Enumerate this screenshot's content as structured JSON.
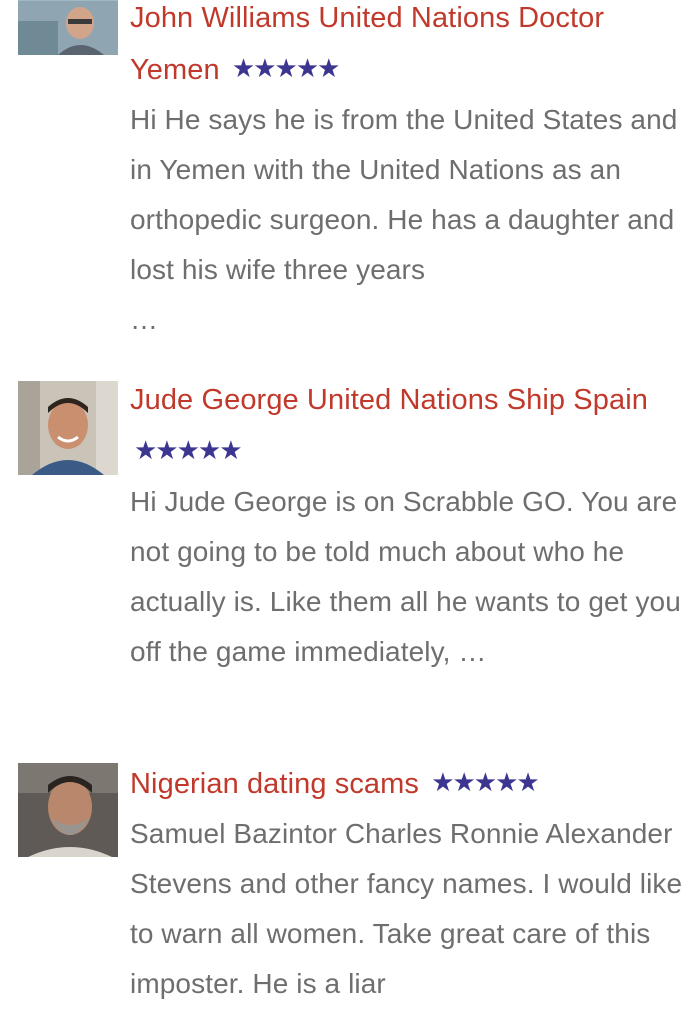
{
  "posts": [
    {
      "title": "John Williams United Nations Doctor Yemen",
      "rating": 5,
      "stars": "★★★★★",
      "excerpt": "Hi He says he is from the United States and in Yemen with the United Nations as an orthopedic surgeon. He has a daughter and lost his wife three years",
      "ellipsis": "…"
    },
    {
      "title": "Jude George United Nations Ship Spain",
      "rating": 5,
      "stars": "★★★★★",
      "excerpt": "Hi Jude George is on Scrabble GO. You are not going to be told much about who he actually is. Like them all he wants to get you off the game immediately, …"
    },
    {
      "title": "Nigerian dating scams",
      "rating": 5,
      "stars": "★★★★★",
      "excerpt": "Samuel Bazintor Charles Ronnie Alexander Stevens and other fancy names. I would like to warn all women. Take great care of this imposter. He is a liar"
    }
  ],
  "colors": {
    "title": "#c0392b",
    "stars": "#3c3690",
    "excerpt": "#6e6e6e"
  }
}
